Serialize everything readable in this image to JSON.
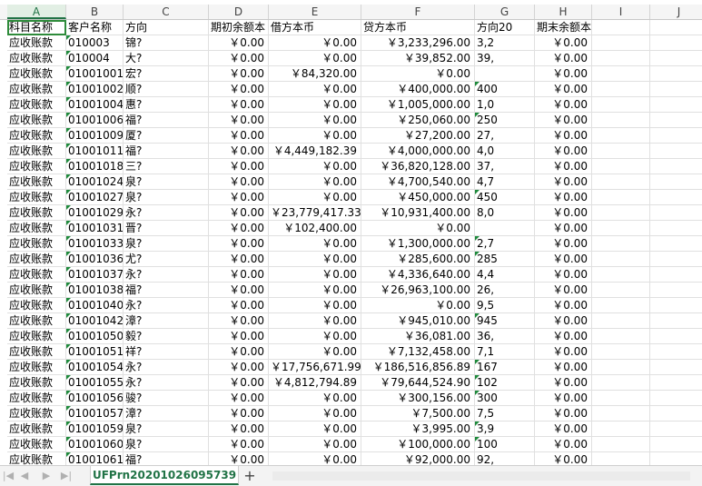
{
  "columns": [
    "A",
    "B",
    "C",
    "D",
    "E",
    "F",
    "G",
    "H",
    "I",
    "J"
  ],
  "selected_column": "A",
  "headers": [
    "科目名称",
    "客户名称",
    "方向",
    "期初余额本",
    "借方本币",
    "贷方本币",
    "方向20",
    "期末余额本币",
    "",
    ""
  ],
  "rows": [
    [
      "应收账款",
      "010003",
      "锦?",
      "￥0.00",
      "￥0.00",
      "￥3,233,296.00",
      "3,2",
      "￥0.00"
    ],
    [
      "应收账款",
      "010004",
      "大?",
      "￥0.00",
      "￥0.00",
      "￥39,852.00",
      "39,",
      "￥0.00"
    ],
    [
      "应收账款",
      "01001001",
      "宏?",
      "￥0.00",
      "￥84,320.00",
      "￥0.00",
      "",
      "￥0.00"
    ],
    [
      "应收账款",
      "01001002",
      "顺?",
      "￥0.00",
      "￥0.00",
      "￥400,000.00",
      "400",
      "￥0.00"
    ],
    [
      "应收账款",
      "01001004",
      "惠?",
      "￥0.00",
      "￥0.00",
      "￥1,005,000.00",
      "1,0",
      "￥0.00"
    ],
    [
      "应收账款",
      "01001006",
      "福?",
      "￥0.00",
      "￥0.00",
      "￥250,060.00",
      "250",
      "￥0.00"
    ],
    [
      "应收账款",
      "01001009",
      "厦?",
      "￥0.00",
      "￥0.00",
      "￥27,200.00",
      "27,",
      "￥0.00"
    ],
    [
      "应收账款",
      "01001011",
      "福?",
      "￥0.00",
      "￥4,449,182.39",
      "￥4,000,000.00",
      "4,0",
      "￥0.00"
    ],
    [
      "应收账款",
      "01001018",
      "三?",
      "￥0.00",
      "￥0.00",
      "￥36,820,128.00",
      "37,",
      "￥0.00"
    ],
    [
      "应收账款",
      "01001024",
      "泉?",
      "￥0.00",
      "￥0.00",
      "￥4,700,540.00",
      "4,7",
      "￥0.00"
    ],
    [
      "应收账款",
      "01001027",
      "泉?",
      "￥0.00",
      "￥0.00",
      "￥450,000.00",
      "450",
      "￥0.00"
    ],
    [
      "应收账款",
      "01001029",
      "永?",
      "￥0.00",
      "￥23,779,417.33",
      "￥10,931,400.00",
      "8,0",
      "￥0.00"
    ],
    [
      "应收账款",
      "01001031",
      "晋?",
      "￥0.00",
      "￥102,400.00",
      "￥0.00",
      "",
      "￥0.00"
    ],
    [
      "应收账款",
      "01001033",
      "泉?",
      "￥0.00",
      "￥0.00",
      "￥1,300,000.00",
      "2,7",
      "￥0.00"
    ],
    [
      "应收账款",
      "01001036",
      "尤?",
      "￥0.00",
      "￥0.00",
      "￥285,600.00",
      "285",
      "￥0.00"
    ],
    [
      "应收账款",
      "01001037",
      "永?",
      "￥0.00",
      "￥0.00",
      "￥4,336,640.00",
      "4,4",
      "￥0.00"
    ],
    [
      "应收账款",
      "01001038",
      "福?",
      "￥0.00",
      "￥0.00",
      "￥26,963,100.00",
      "26,",
      "￥0.00"
    ],
    [
      "应收账款",
      "01001040",
      "永?",
      "￥0.00",
      "￥0.00",
      "￥0.00",
      "9,5",
      "￥0.00"
    ],
    [
      "应收账款",
      "01001042",
      "漳?",
      "￥0.00",
      "￥0.00",
      "￥945,010.00",
      "945",
      "￥0.00"
    ],
    [
      "应收账款",
      "01001050",
      "毅?",
      "￥0.00",
      "￥0.00",
      "￥36,081.00",
      "36,",
      "￥0.00"
    ],
    [
      "应收账款",
      "01001051",
      "祥?",
      "￥0.00",
      "￥0.00",
      "￥7,132,458.00",
      "7,1",
      "￥0.00"
    ],
    [
      "应收账款",
      "01001054",
      "永?",
      "￥0.00",
      "￥17,756,671.99",
      "￥186,516,856.89",
      "167",
      "￥0.00"
    ],
    [
      "应收账款",
      "01001055",
      "永?",
      "￥0.00",
      "￥4,812,794.89",
      "￥79,644,524.90",
      "102",
      "￥0.00"
    ],
    [
      "应收账款",
      "01001056",
      "骏?",
      "￥0.00",
      "￥0.00",
      "￥300,156.00",
      "300",
      "￥0.00"
    ],
    [
      "应收账款",
      "01001057",
      "漳?",
      "￥0.00",
      "￥0.00",
      "￥7,500.00",
      "7,5",
      "￥0.00"
    ],
    [
      "应收账款",
      "01001059",
      "泉?",
      "￥0.00",
      "￥0.00",
      "￥3,995.00",
      "3,9",
      "￥0.00"
    ],
    [
      "应收账款",
      "01001060",
      "泉?",
      "￥0.00",
      "￥0.00",
      "￥100,000.00",
      "100",
      "￥0.00"
    ],
    [
      "应收账款",
      "01001061",
      "福?",
      "￥0.00",
      "￥0.00",
      "￥92,000.00",
      "92,",
      "￥0.00"
    ]
  ],
  "g_flag_rows": [
    3,
    5,
    10,
    13,
    14,
    18,
    21,
    22,
    23,
    25,
    26
  ],
  "sheet_tab": "UFPrn20201026095739",
  "nav": {
    "first": "|◀",
    "prev": "◀",
    "next": "▶",
    "last": "▶|"
  },
  "add_tab_label": "+",
  "colors": {
    "accent": "#217346",
    "flag": "#1f8a3c"
  }
}
